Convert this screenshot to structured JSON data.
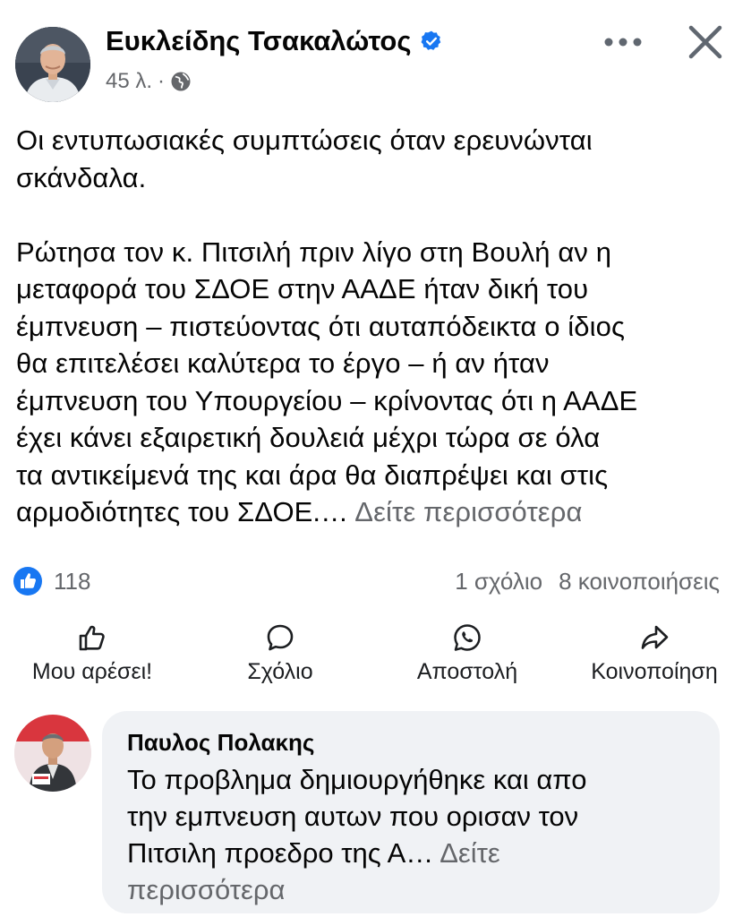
{
  "post": {
    "author": "Ευκλείδης Τσακαλώτος",
    "time": "45 λ.",
    "separator": "·",
    "text_main": "Οι εντυπωσιακές συμπτώσεις όταν ερευνώνται\nσκάνδαλα.\n\nΡώτησα τον κ. Πιτσιλή πριν λίγο στη Βουλή αν η\nμεταφορά του ΣΔΟΕ στην ΑΑΔΕ ήταν δική του\nέμπνευση – πιστεύοντας ότι αυταπόδεικτα ο ίδιος\nθα επιτελέσει καλύτερα το έργο – ή αν ήταν\nέμπνευση του Υπουργείου – κρίνοντας ότι η ΑΑΔΕ\nέχει κάνει εξαιρετική δουλειά μέχρι τώρα σε όλα\nτα αντικείμενά της και άρα θα διαπρέψει και στις\nαρμοδιότητες του ΣΔΟΕ.…",
    "see_more": "Δείτε περισσότερα"
  },
  "stats": {
    "likes": "118",
    "comments": "1 σχόλιο",
    "shares": "8 κοινοποιήσεις"
  },
  "actions": {
    "like": "Μου αρέσει!",
    "comment": "Σχόλιο",
    "send": "Αποστολή",
    "share": "Κοινοποίηση"
  },
  "comment": {
    "author": "Παυλος Πολακης",
    "text": "Το προβλημα δημιουργήθηκε και απο\nτην  εμπνευση αυτων που ορισαν τον\nΠιτσιλη προεδρο της Α…",
    "see_more": "Δείτε\nπερισσότερα"
  },
  "icons": {
    "verified": "verified-badge-icon",
    "globe": "globe-icon",
    "more": "more-options-icon",
    "close": "close-icon",
    "like_reaction": "like-reaction-icon",
    "like": "thumbs-up-icon",
    "comment": "comment-bubble-icon",
    "send": "whatsapp-icon",
    "share": "share-arrow-icon"
  },
  "colors": {
    "brand_blue": "#1877f2",
    "secondary_text": "#65676b",
    "comment_bubble": "#f0f2f5"
  }
}
